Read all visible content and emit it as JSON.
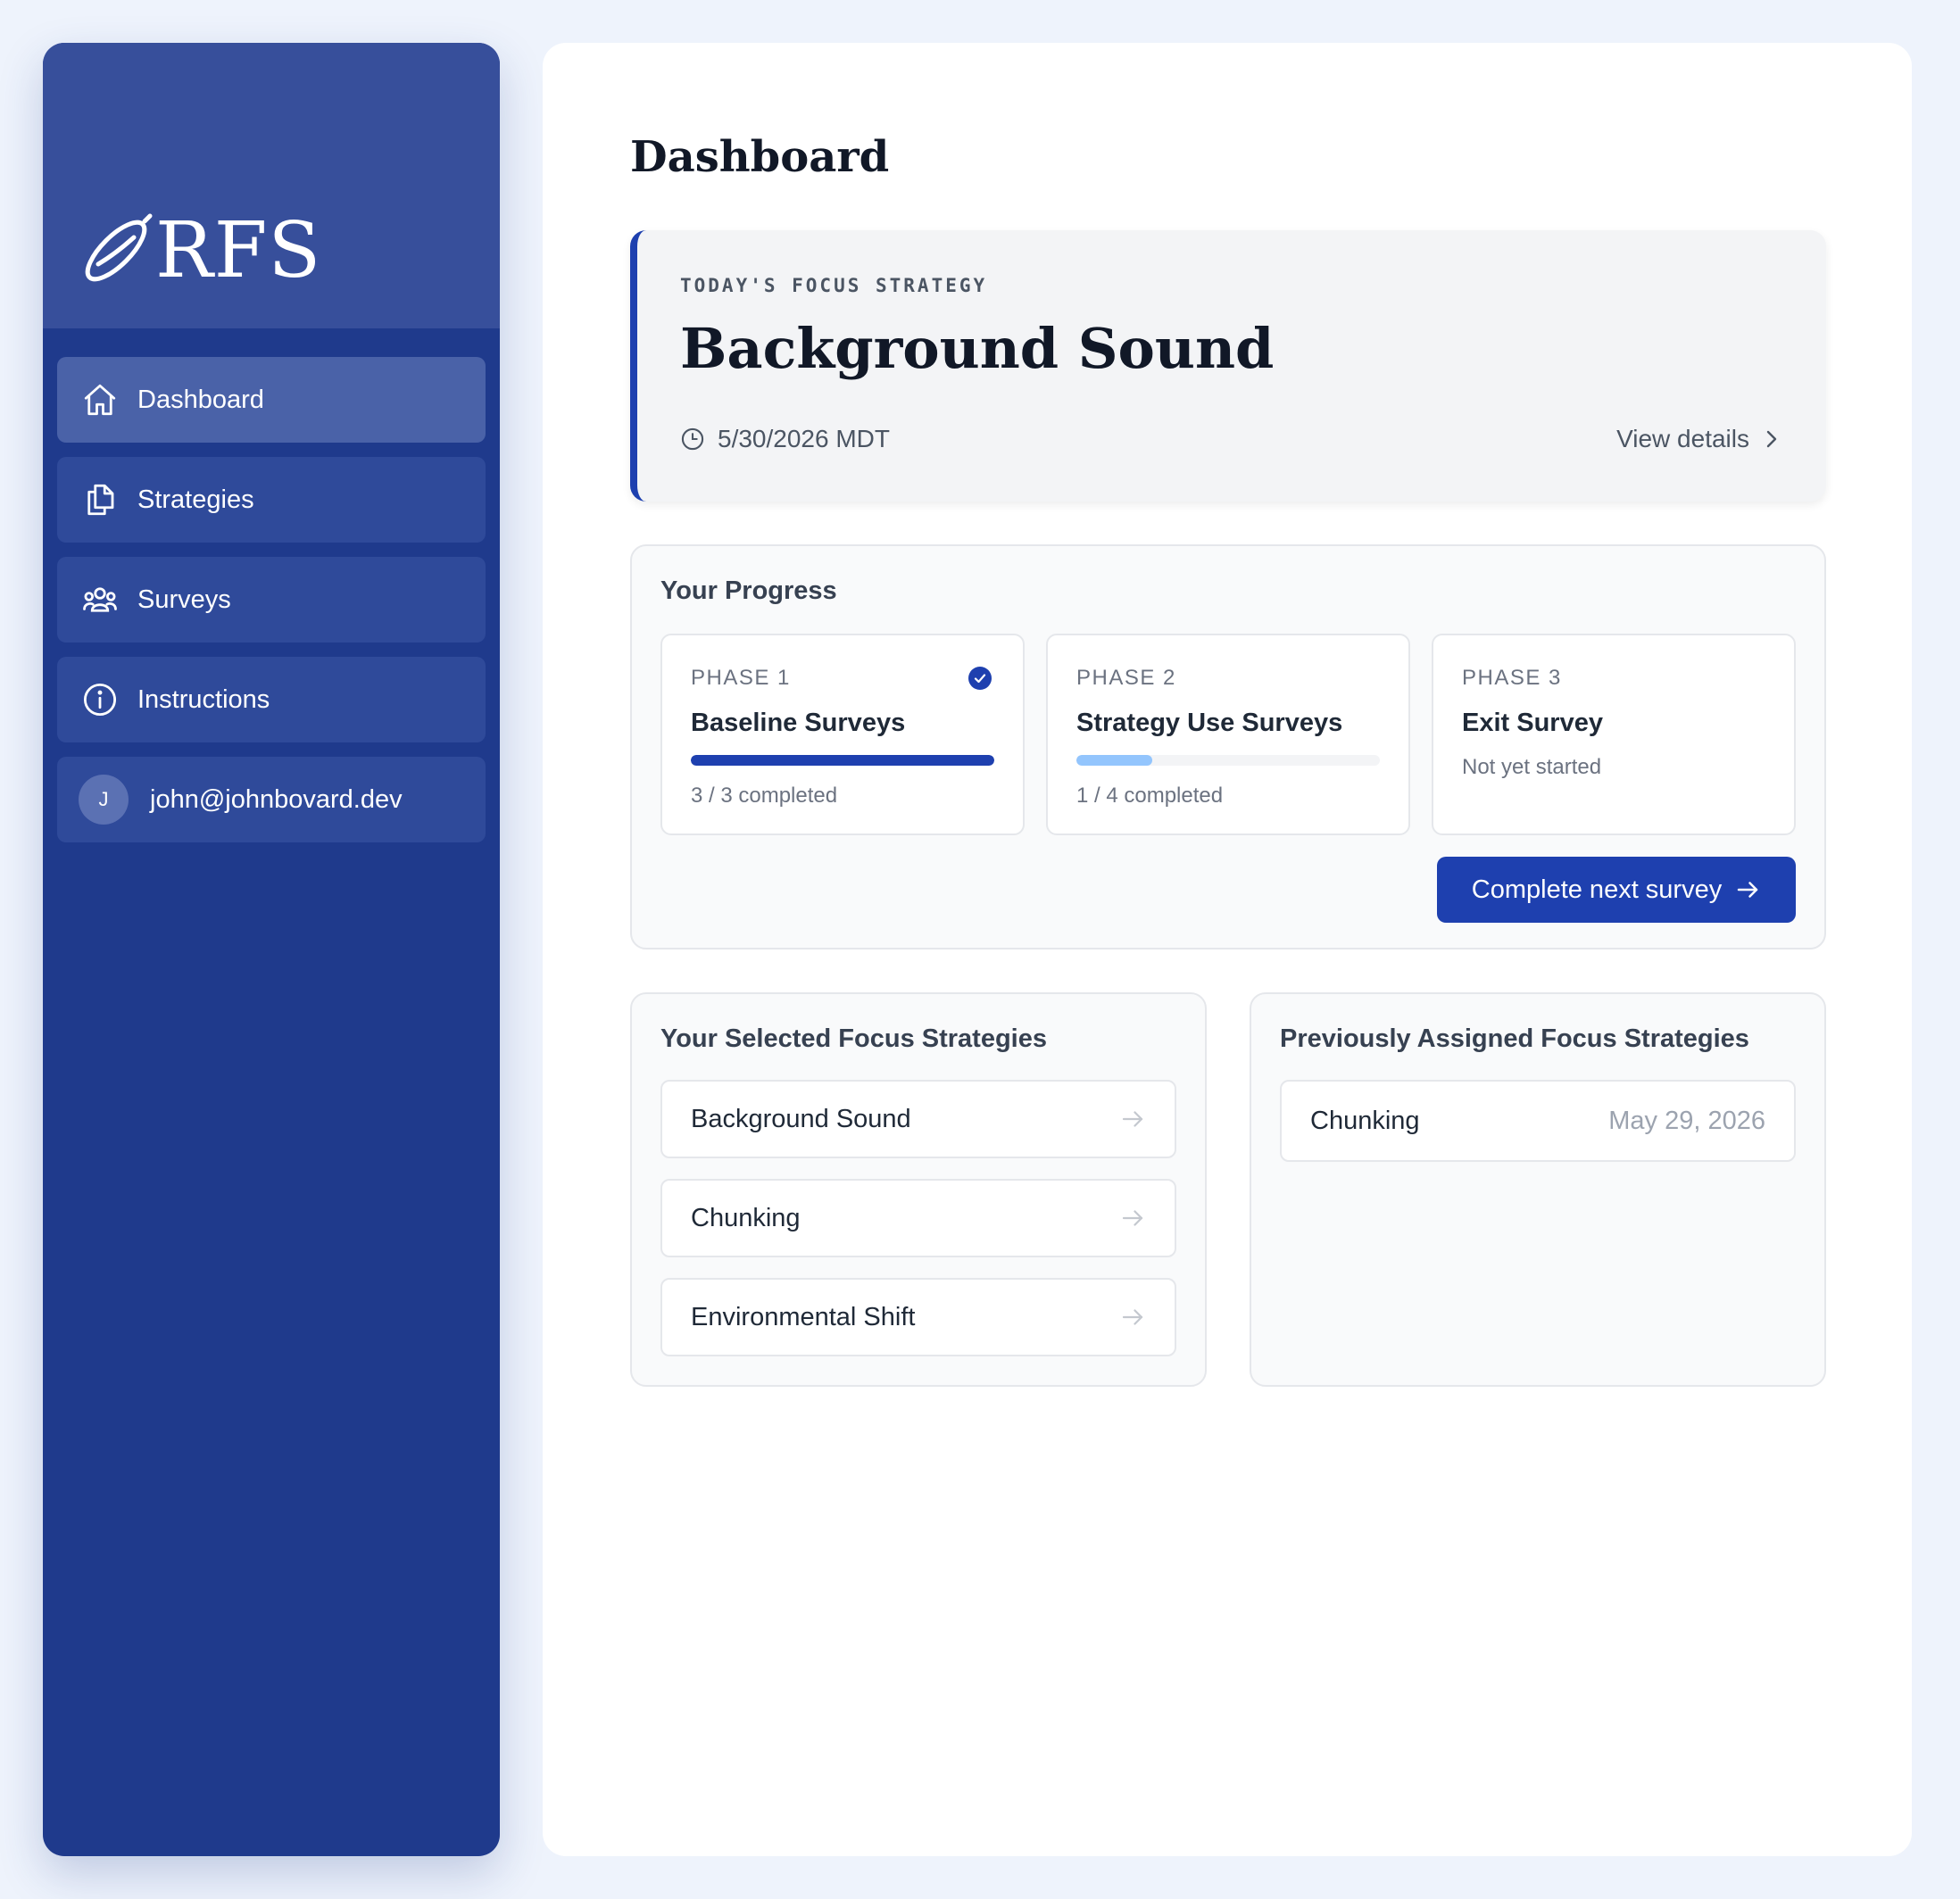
{
  "brand": {
    "name": "RFS"
  },
  "sidebar": {
    "items": [
      {
        "label": "Dashboard",
        "icon": "home-icon",
        "active": true
      },
      {
        "label": "Strategies",
        "icon": "documents-icon",
        "active": false
      },
      {
        "label": "Surveys",
        "icon": "users-icon",
        "active": false
      },
      {
        "label": "Instructions",
        "icon": "info-icon",
        "active": false
      }
    ],
    "user": {
      "initial": "J",
      "email": "john@johnbovard.dev"
    }
  },
  "page": {
    "title": "Dashboard"
  },
  "focus": {
    "eyebrow": "TODAY'S FOCUS STRATEGY",
    "title": "Background Sound",
    "date": "5/30/2026 MDT",
    "view_details": "View details"
  },
  "progress": {
    "title": "Your Progress",
    "phases": [
      {
        "label": "PHASE 1",
        "name": "Baseline Surveys",
        "status": "3 / 3 completed",
        "progress": 1.0,
        "complete": true,
        "bar_color": "#1e40af"
      },
      {
        "label": "PHASE 2",
        "name": "Strategy Use Surveys",
        "status": "1 / 4 completed",
        "progress": 0.25,
        "complete": false,
        "bar_color": "#93c5fd"
      },
      {
        "label": "PHASE 3",
        "name": "Exit Survey",
        "status": "Not yet started",
        "complete": false
      }
    ],
    "cta": "Complete next survey"
  },
  "selected": {
    "title": "Your Selected Focus Strategies",
    "items": [
      "Background Sound",
      "Chunking",
      "Environmental Shift"
    ]
  },
  "previous": {
    "title": "Previously Assigned Focus Strategies",
    "items": [
      {
        "name": "Chunking",
        "date": "May 29, 2026"
      }
    ]
  },
  "colors": {
    "sidebar": "#1f3a8c",
    "accent": "#1e40af",
    "progress_light": "#93c5fd"
  }
}
